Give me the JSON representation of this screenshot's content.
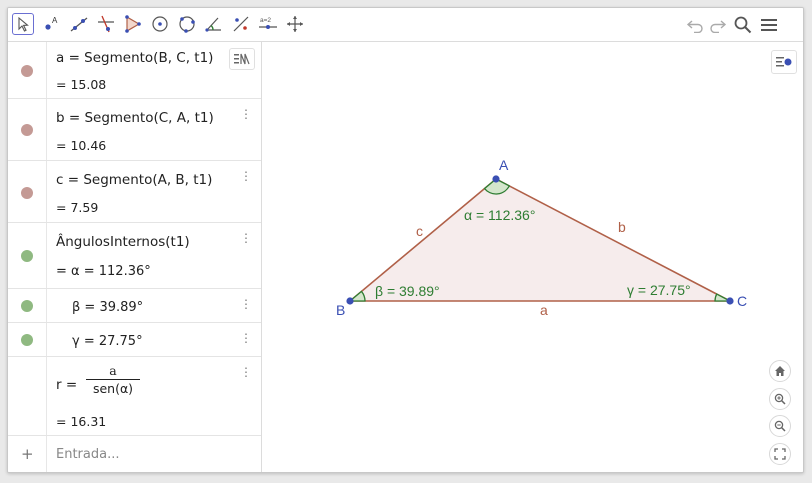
{
  "toolbar": {
    "tools": [
      "move-tool-icon",
      "point-tool-icon",
      "line-tool-icon",
      "perpendicular-line-tool-icon",
      "polygon-tool-icon",
      "circle-tool-icon",
      "circle-through-points-tool-icon",
      "angle-tool-icon",
      "reflect-tool-icon",
      "slider-tool-icon",
      "move-graphics-view-tool-icon"
    ],
    "slider_glyph": "a=2",
    "right_icons": [
      "undo-icon",
      "redo-icon",
      "search-icon",
      "menu-icon"
    ]
  },
  "algebra": {
    "rows": [
      {
        "def": "a = Segmento(B, C, t1)",
        "value": "= 15.08",
        "color": "#c49a95"
      },
      {
        "def": "b = Segmento(C, A, t1)",
        "value": "= 10.46",
        "color": "#c49a95"
      },
      {
        "def": "c = Segmento(A, B, t1)",
        "value": "= 7.59",
        "color": "#c49a95"
      },
      {
        "def": "ÂngulosInternos(t1)",
        "value": "= α = 112.36°",
        "color": "#8fb981"
      },
      {
        "def": "β = 39.89°",
        "color": "#8fb981"
      },
      {
        "def": "γ = 27.75°",
        "color": "#8fb981"
      },
      {
        "lhs": "r =",
        "num": "a",
        "den": "sen(α)",
        "value": "= 16.31"
      }
    ],
    "sort_icon": "algebra-style-icon",
    "input_placeholder": "Entrada...",
    "input_plus": "+"
  },
  "graphics": {
    "points": {
      "A": "A",
      "B": "B",
      "C": "C"
    },
    "sides": {
      "a": "a",
      "b": "b",
      "c": "c"
    },
    "angles": {
      "alpha": "α = 112.36°",
      "beta": "β = 39.89°",
      "gamma": "γ = 27.75°"
    },
    "zoom_buttons": [
      "home-icon",
      "zoom-in-icon",
      "zoom-out-icon",
      "fullscreen-icon"
    ],
    "style_bar_icon": "graphics-style-bar-icon"
  },
  "colors": {
    "point": "#3a4fb3",
    "segment": "#b06048",
    "angle": "#2e7d32",
    "fill": "#f6ecec",
    "marble_segment": "#c49a95",
    "marble_angle": "#8fb981",
    "selected_tool": "#6a6fd2"
  }
}
